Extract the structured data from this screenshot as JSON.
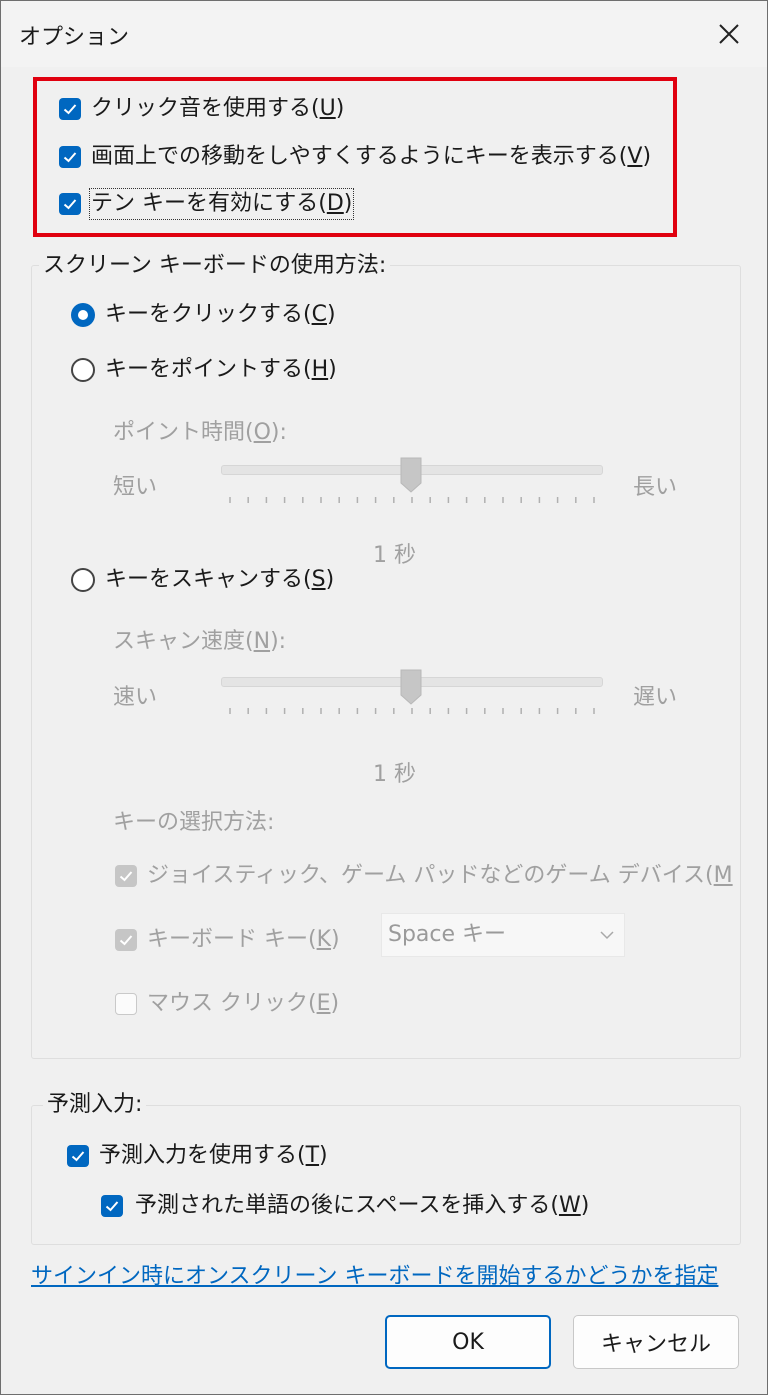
{
  "window": {
    "title": "オプション"
  },
  "options": [
    {
      "prefix": "クリック音を使用する(",
      "key": "U",
      "suffix": ")",
      "checked": true
    },
    {
      "prefix": "画面上での移動をしやすくするようにキーを表示する(",
      "key": "V",
      "suffix": ")",
      "checked": true
    },
    {
      "prefix": "テン キーを有効にする(",
      "key": "D",
      "suffix": ")",
      "checked": true
    }
  ],
  "usage": {
    "legend": "スクリーン キーボードの使用方法:",
    "click": {
      "prefix": "キーをクリックする(",
      "key": "C",
      "suffix": ")",
      "selected": true
    },
    "point": {
      "prefix": "キーをポイントする(",
      "key": "H",
      "suffix": ")",
      "selected": false
    },
    "point_time": {
      "prefix": "ポイント時間(",
      "key": "O",
      "suffix": "):",
      "min": "短い",
      "max": "長い",
      "value": "1 秒",
      "level": 0.5
    },
    "scan": {
      "prefix": "キーをスキャンする(",
      "key": "S",
      "suffix": ")",
      "selected": false
    },
    "scan_speed": {
      "prefix": "スキャン速度(",
      "key": "N",
      "suffix": "):",
      "min": "速い",
      "max": "遅い",
      "value": "1 秒",
      "level": 0.5
    },
    "select_method": {
      "label": "キーの選択方法:",
      "joystick": {
        "prefix": "ジョイスティック、ゲーム パッドなどのゲーム デバイス(",
        "key": "M",
        "checked": true
      },
      "keyboard": {
        "prefix": "キーボード キー(",
        "key": "K",
        "suffix": ")",
        "checked": true,
        "dropdown": "Space キー"
      },
      "mouse": {
        "prefix": "マウス クリック(",
        "key": "E",
        "suffix": ")",
        "checked": false
      }
    }
  },
  "prediction": {
    "legend": "予測入力:",
    "use": {
      "prefix": "予測入力を使用する(",
      "key": "T",
      "suffix": ")",
      "checked": true
    },
    "space": {
      "prefix": "予測された単語の後にスペースを挿入する(",
      "key": "W",
      "suffix": ")",
      "checked": true
    }
  },
  "signin_link": "サインイン時にオンスクリーン キーボードを開始するかどうかを指定",
  "buttons": {
    "ok": "OK",
    "cancel": "キャンセル"
  },
  "colors": {
    "accent": "#0067c0",
    "highlight": "#e0000f"
  },
  "icons": {
    "close": "close-icon",
    "check": "checkmark-icon",
    "dropdown": "chevron-down-icon"
  }
}
